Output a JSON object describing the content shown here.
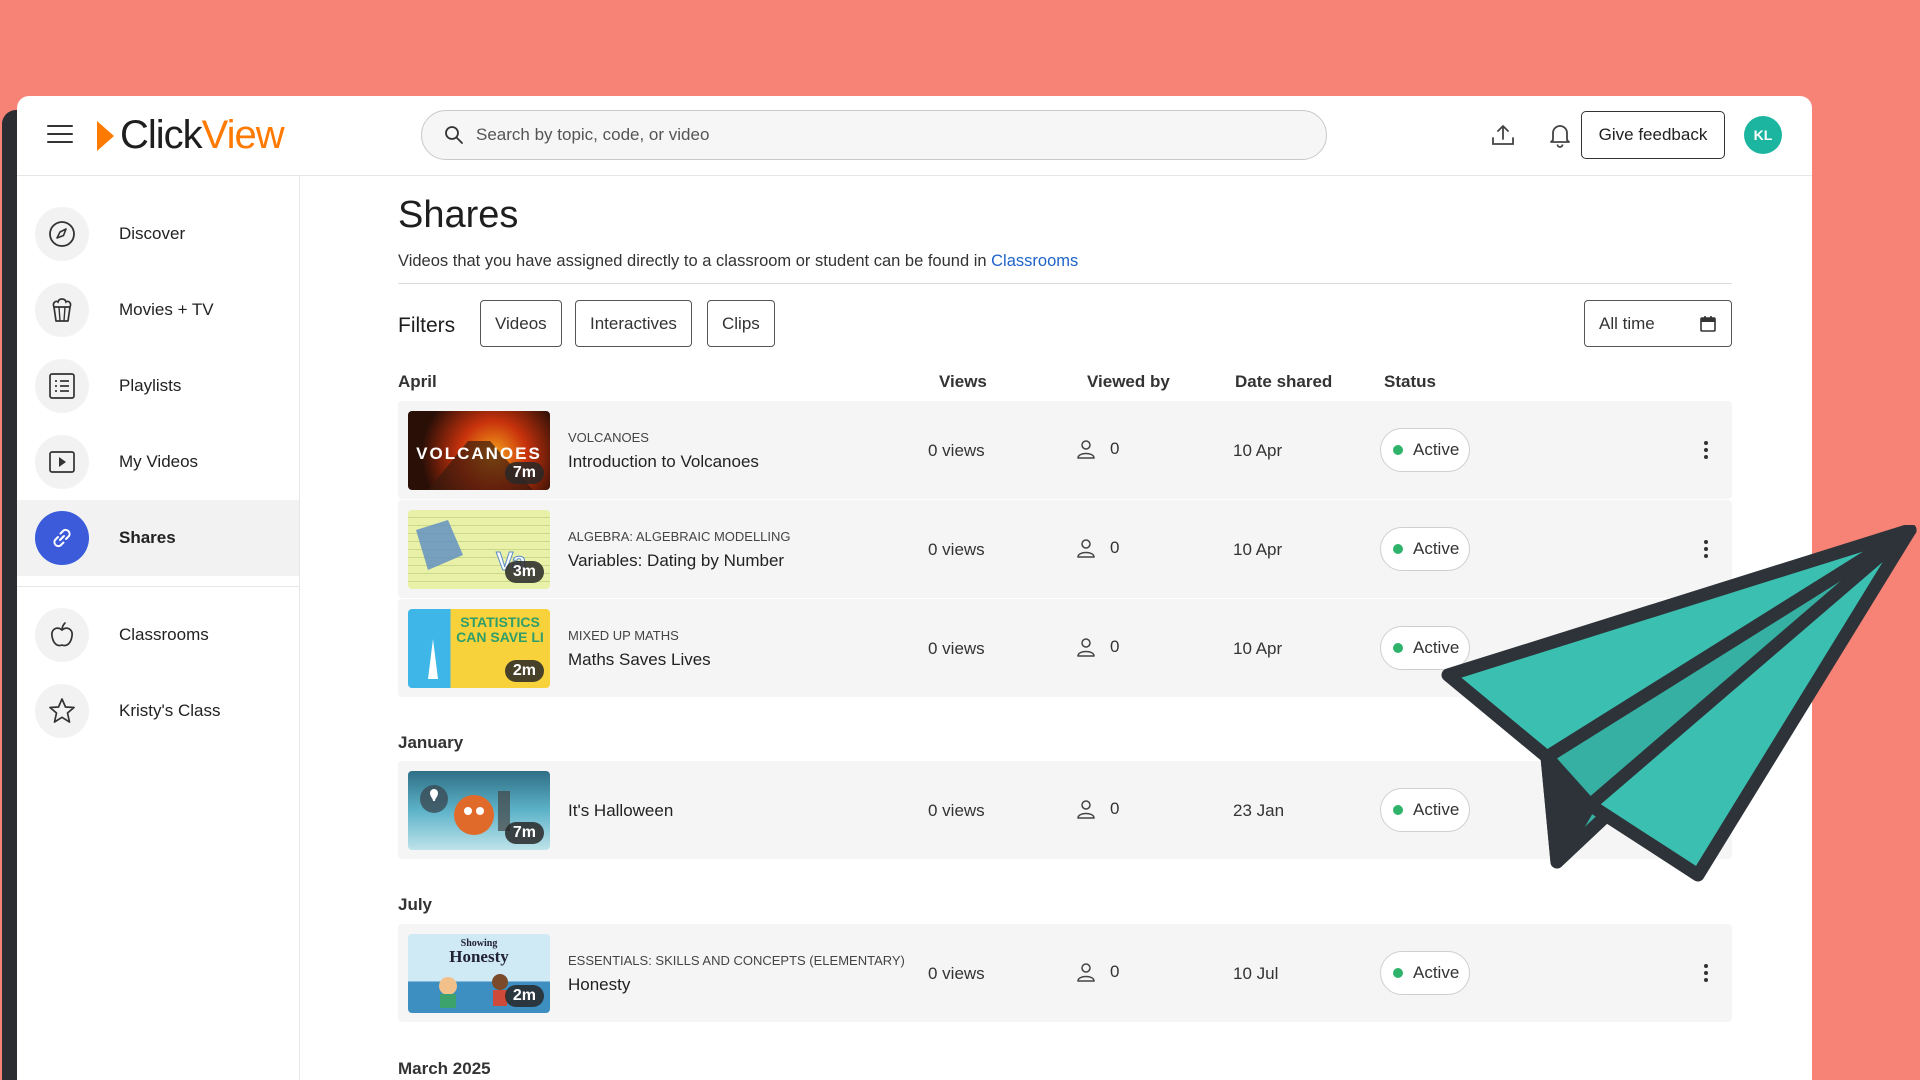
{
  "header": {
    "logo_click": "Click",
    "logo_view": "View",
    "search_placeholder": "Search by topic, code, or video",
    "feedback_label": "Give feedback",
    "avatar_initials": "KL"
  },
  "sidebar": {
    "items": [
      {
        "label": "Discover",
        "icon": "compass-icon"
      },
      {
        "label": "Movies + TV",
        "icon": "popcorn-icon"
      },
      {
        "label": "Playlists",
        "icon": "list-icon"
      },
      {
        "label": "My Videos",
        "icon": "play-icon"
      },
      {
        "label": "Shares",
        "icon": "link-icon",
        "active": true
      },
      {
        "label": "Classrooms",
        "icon": "apple-icon"
      },
      {
        "label": "Kristy's Class",
        "icon": "star-icon"
      }
    ]
  },
  "main": {
    "title": "Shares",
    "subtitle": "Videos that you have assigned directly to a classroom or student can be found in ",
    "subtitle_link": "Classrooms",
    "filters_label": "Filters",
    "filters": [
      "Videos",
      "Interactives",
      "Clips"
    ],
    "date_filter": "All time",
    "columns": {
      "views": "Views",
      "viewed_by": "Viewed by",
      "date_shared": "Date shared",
      "status": "Status"
    },
    "groups": [
      {
        "label": "April",
        "rows": [
          {
            "category": "VOLCANOES",
            "title": "Introduction to Volcanoes",
            "duration": "7m",
            "thumb_text": "VOLCANOES",
            "views": "0 views",
            "viewed_by": "0",
            "date": "10 Apr",
            "status": "Active"
          },
          {
            "category": "ALGEBRA: ALGEBRAIC MODELLING",
            "title": "Variables: Dating by Number",
            "duration": "3m",
            "thumb_text": "Va",
            "views": "0 views",
            "viewed_by": "0",
            "date": "10 Apr",
            "status": "Active"
          },
          {
            "category": "MIXED UP MATHS",
            "title": "Maths Saves Lives",
            "duration": "2m",
            "thumb_text": "STATISTICS CAN SAVE LI",
            "views": "0 views",
            "viewed_by": "0",
            "date": "10 Apr",
            "status": "Active"
          }
        ]
      },
      {
        "label": "January",
        "rows": [
          {
            "category": "",
            "title": "It's Halloween",
            "duration": "7m",
            "views": "0 views",
            "viewed_by": "0",
            "date": "23 Jan",
            "status": "Active"
          }
        ]
      },
      {
        "label": "July",
        "rows": [
          {
            "category": "ESSENTIALS: SKILLS AND CONCEPTS (ELEMENTARY)",
            "title": "Honesty",
            "duration": "2m",
            "thumb_text_small": "Showing",
            "thumb_text": "Honesty",
            "views": "0 views",
            "viewed_by": "0",
            "date": "10 Jul",
            "status": "Active"
          }
        ]
      },
      {
        "label": "March 2025",
        "rows": []
      }
    ]
  },
  "colors": {
    "background": "#f78377",
    "accent": "#ff7a00",
    "active_nav": "#3b5bdb",
    "plane": "#3bbfb0",
    "status_dot": "#2fb36b"
  }
}
